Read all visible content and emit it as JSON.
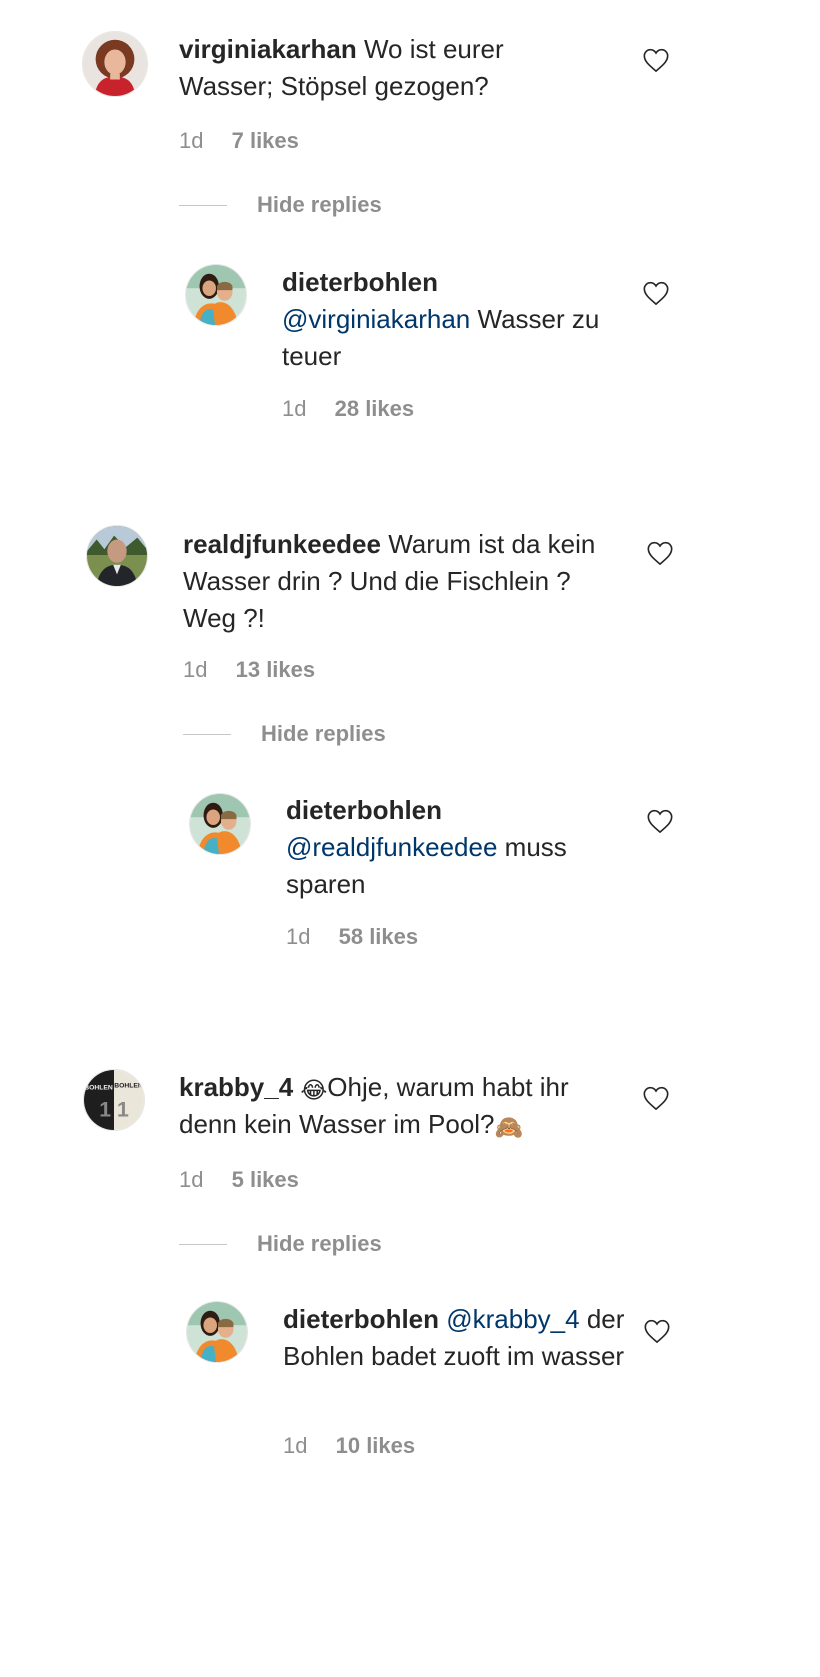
{
  "colors": {
    "text": "#262626",
    "secondary": "#8e8e8e",
    "mention": "#00376b",
    "divider": "#c7c7c7"
  },
  "threads": [
    {
      "comment": {
        "username": "virginiakarhan",
        "text": "Wo ist eurer Wasser; Stöpsel gezogen?",
        "time": "1d",
        "likes": "7 likes"
      },
      "hide_replies_label": "Hide replies",
      "reply": {
        "username": "dieterbohlen",
        "mention": "@virginiakarhan",
        "text": "Wasser zu teuer",
        "time": "1d",
        "likes": "28 likes"
      }
    },
    {
      "comment": {
        "username": "realdjfunkeedee",
        "text": "Warum ist da kein Wasser drin ? Und die Fischlein ? Weg ?!",
        "time": "1d",
        "likes": "13 likes"
      },
      "hide_replies_label": "Hide replies",
      "reply": {
        "username": "dieterbohlen",
        "mention": "@realdjfunkeedee",
        "text": "muss sparen",
        "time": "1d",
        "likes": "58 likes"
      }
    },
    {
      "comment": {
        "username": "krabby_4",
        "emoji_start": "😂",
        "text": "Ohje, warum habt ihr denn kein Wasser im Pool?",
        "emoji_end": "🙈",
        "time": "1d",
        "likes": "5 likes",
        "avatar_text_left": "BOHLEN",
        "avatar_text_right": "BOHLEN",
        "avatar_numbers": "1 1"
      },
      "hide_replies_label": "Hide replies",
      "reply": {
        "username": "dieterbohlen",
        "mention": "@krabby_4",
        "text": "der Bohlen badet zuoft im wasser",
        "time": "1d",
        "likes": "10 likes"
      }
    }
  ]
}
